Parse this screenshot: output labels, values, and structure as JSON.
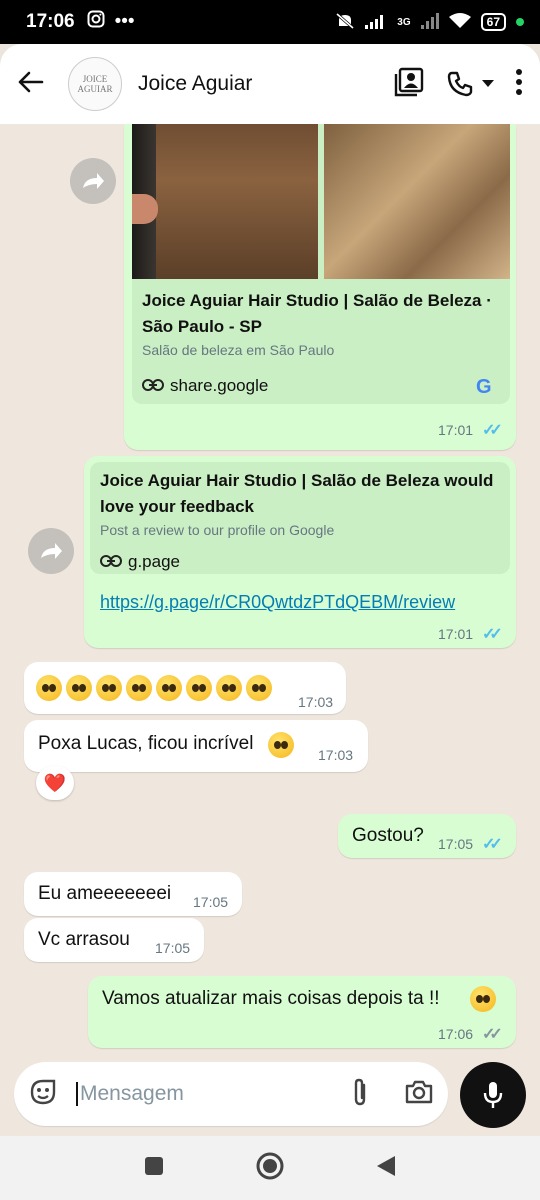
{
  "status_bar": {
    "time": "17:06",
    "network": "3G",
    "battery": "67"
  },
  "header": {
    "contact_name": "Joice Aguiar",
    "avatar_text_top": "JOICE",
    "avatar_text_bottom": "AGUIAR"
  },
  "messages": {
    "m1": {
      "preview_title": "Joice Aguiar Hair Studio | Salão de Beleza · São Paulo - SP",
      "preview_subtitle": "Salão de beleza em São Paulo",
      "preview_domain": "share.google",
      "time": "17:01"
    },
    "m2": {
      "preview_title": "Joice Aguiar Hair Studio | Salão de Beleza would love your feedback",
      "preview_subtitle": "Post a review to our profile on Google",
      "preview_domain": "g.page",
      "link": "https://g.page/r/CR0QwtdzPTdQEBM/review",
      "time": "17:01"
    },
    "m3": {
      "time": "17:03"
    },
    "m4": {
      "text": "Poxa Lucas, ficou incrível",
      "time": "17:03",
      "reaction": "❤️"
    },
    "m5": {
      "text": "Gostou?",
      "time": "17:05"
    },
    "m6": {
      "text": "Eu ameeeeeeei",
      "time": "17:05"
    },
    "m7": {
      "text": "Vc arrasou",
      "time": "17:05"
    },
    "m8": {
      "text": "Vamos atualizar mais coisas depois ta !!",
      "time": "17:06"
    }
  },
  "composer": {
    "placeholder": "Mensagem"
  },
  "colors": {
    "outgoing": "#D9FDD3",
    "incoming": "#FFFFFF",
    "read_ticks": "#53BDEB",
    "link": "#027EB5"
  }
}
